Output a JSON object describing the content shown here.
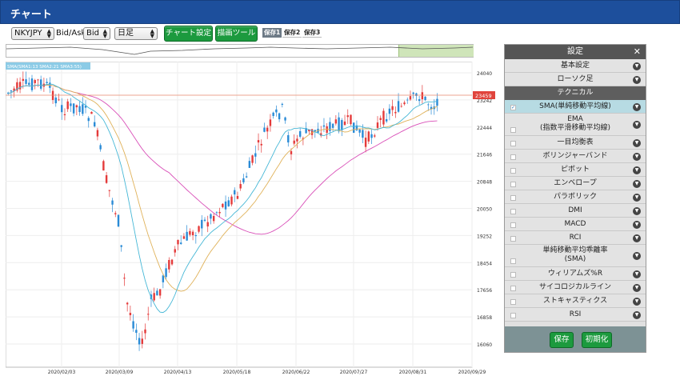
{
  "header": {
    "title": "チャート"
  },
  "toolbar": {
    "symbol": "NKYJPY",
    "bidask_label": "Bid/Ask",
    "bidask_value": "Bid",
    "timeframe": "日足",
    "chart_settings": "チャート設定",
    "drawing_tools": "描画ツール",
    "save_tabs": [
      "保存1",
      "保存2",
      "保存3"
    ]
  },
  "chart": {
    "legend": "SMA(SMA1:13  SMA2:21  SMA3:55)",
    "current_price": "23459",
    "y_ticks": [
      "24040",
      "23242",
      "22444",
      "21646",
      "20848",
      "20050",
      "19252",
      "18454",
      "17656",
      "16858",
      "16060"
    ],
    "x_ticks": [
      "2020/02/03",
      "2020/03/09",
      "2020/04/13",
      "2020/05/18",
      "2020/06/22",
      "2020/07/27",
      "2020/08/31",
      "2020/09/29"
    ],
    "colors": {
      "up": "#e43a3a",
      "down": "#2a8bd6",
      "sma1": "#45b7d6",
      "sma2": "#e0b25a",
      "sma3": "#d94fb8",
      "price_line": "#e8896b"
    }
  },
  "panel": {
    "title": "設定",
    "close": "✕",
    "rows": [
      {
        "label": "基本設定",
        "type": "plain"
      },
      {
        "label": "ローソク足",
        "type": "plain"
      },
      {
        "label": "テクニカル",
        "type": "section"
      },
      {
        "label": "SMA(単純移動平均線)",
        "type": "item",
        "checked": true,
        "highlight": true
      },
      {
        "label": "EMA",
        "label2": "(指数平滑移動平均線)",
        "type": "item"
      },
      {
        "label": "一目均衡表",
        "type": "item"
      },
      {
        "label": "ボリンジャーバンド",
        "type": "item"
      },
      {
        "label": "ピボット",
        "type": "item"
      },
      {
        "label": "エンベロープ",
        "type": "item"
      },
      {
        "label": "パラボリック",
        "type": "item"
      },
      {
        "label": "DMI",
        "type": "item"
      },
      {
        "label": "MACD",
        "type": "item"
      },
      {
        "label": "RCI",
        "type": "item"
      },
      {
        "label": "単純移動平均乖離率",
        "label2": "(SMA)",
        "type": "item"
      },
      {
        "label": "ウィリアムズ%R",
        "type": "item"
      },
      {
        "label": "サイコロジカルライン",
        "type": "item"
      },
      {
        "label": "ストキャスティクス",
        "type": "item"
      },
      {
        "label": "RSI",
        "type": "item"
      }
    ],
    "save_button": "保存",
    "reset_button": "初期化"
  }
}
